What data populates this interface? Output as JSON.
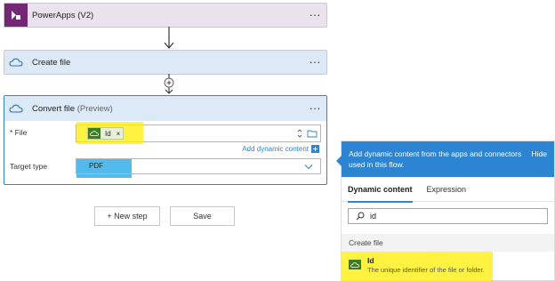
{
  "steps": {
    "powerapps": {
      "title": "PowerApps (V2)",
      "menu": "···"
    },
    "create_file": {
      "title": "Create file",
      "menu": "···"
    },
    "convert_file": {
      "title": "Convert file",
      "subtitle": "(Preview)",
      "menu": "···",
      "file_label": "* File",
      "file_token": "Id",
      "token_remove": "×",
      "add_dynamic": "Add dynamic content",
      "target_label": "Target type",
      "target_value": "PDF"
    }
  },
  "actions": {
    "new_step": "+ New step",
    "save": "Save"
  },
  "dynamic_panel": {
    "header_text": "Add dynamic content from the apps and connectors used in this flow.",
    "hide": "Hide",
    "tabs": [
      "Dynamic content",
      "Expression"
    ],
    "search_value": "id",
    "section": "Create file",
    "item": {
      "title": "Id",
      "description": "The unique identifier of the file or folder."
    }
  },
  "colors": {
    "accent": "#2d84d2",
    "powerapps": "#742774",
    "onedrive_icon": "#3c7d22",
    "highlight_yellow": "#ffee00",
    "highlight_blue": "#35afe8"
  }
}
